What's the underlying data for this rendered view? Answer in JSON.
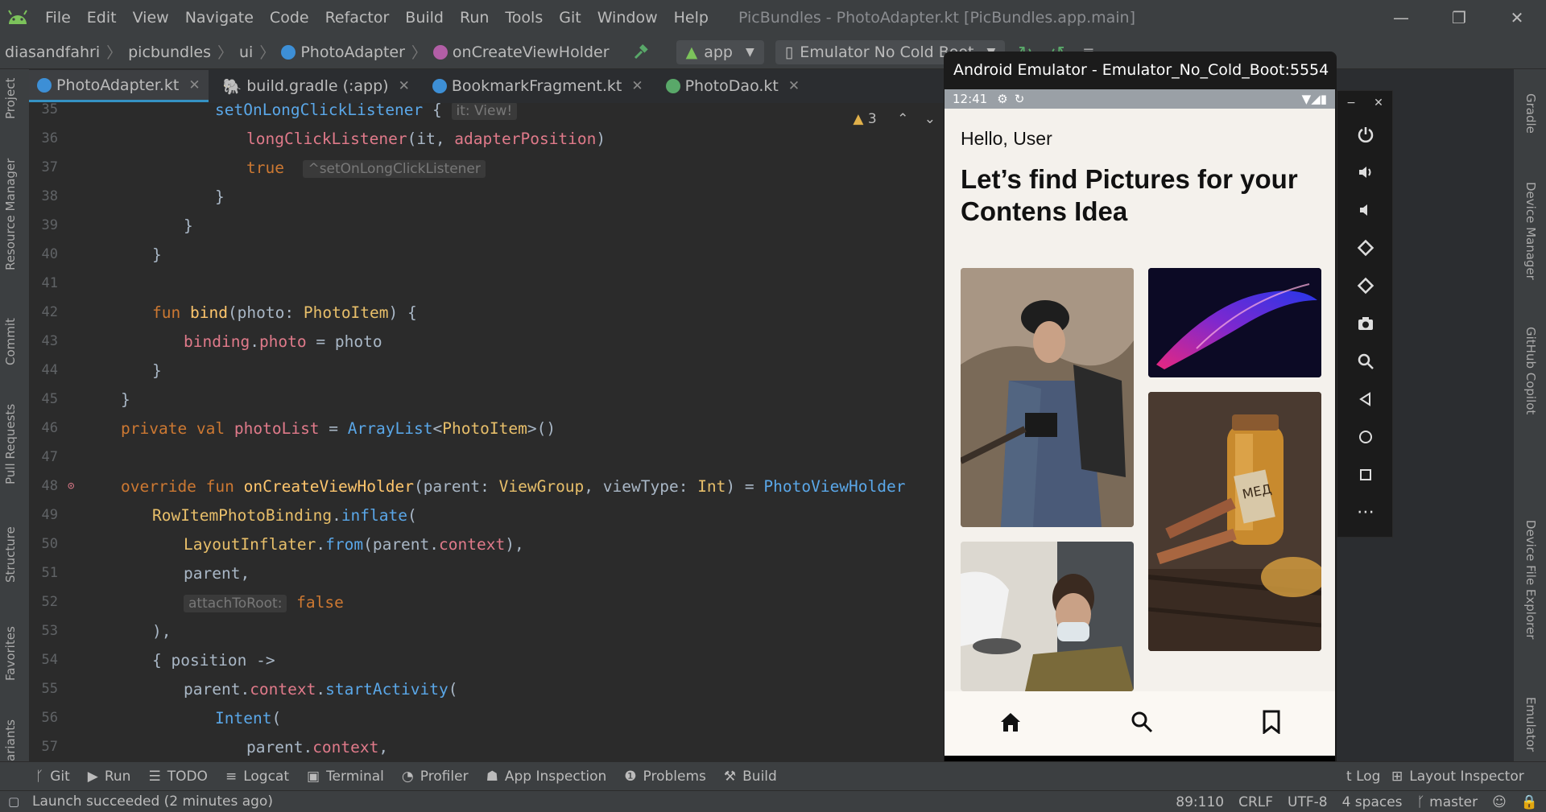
{
  "window": {
    "title": "PicBundles - PhotoAdapter.kt [PicBundles.app.main]",
    "menu": [
      "File",
      "Edit",
      "View",
      "Navigate",
      "Code",
      "Refactor",
      "Build",
      "Run",
      "Tools",
      "Git",
      "Window",
      "Help"
    ],
    "controls": {
      "minimize": "—",
      "restore": "❐",
      "close": "✕"
    }
  },
  "breadcrumb": [
    "diasandfahri",
    "picbundles",
    "ui",
    "PhotoAdapter",
    "onCreateViewHolder"
  ],
  "toolbar": {
    "run_config": "app",
    "device": "Emulator No Cold Boot"
  },
  "tabs": [
    {
      "label": "PhotoAdapter.kt",
      "active": true
    },
    {
      "label": "build.gradle (:app)",
      "active": false
    },
    {
      "label": "BookmarkFragment.kt",
      "active": false
    },
    {
      "label": "PhotoDao.kt",
      "active": false
    }
  ],
  "left_tools": [
    "Project",
    "Resource Manager",
    "Commit",
    "Pull Requests",
    "Structure",
    "Favorites",
    "ariants"
  ],
  "right_tools": [
    "Gradle",
    "Device Manager",
    "GitHub Copilot",
    "Device File Explorer",
    "Emulator"
  ],
  "editor": {
    "warnings": "3",
    "lines": [
      {
        "n": "35",
        "text": "                setOnLongClickListener {",
        "hint": "it: View!"
      },
      {
        "n": "36",
        "text": "                    longClickListener(it, adapterPosition)"
      },
      {
        "n": "37",
        "text": "                    true",
        "hint": "^setOnLongClickListener"
      },
      {
        "n": "38",
        "text": "                }"
      },
      {
        "n": "39",
        "text": "            }"
      },
      {
        "n": "40",
        "text": "        }"
      },
      {
        "n": "41",
        "text": ""
      },
      {
        "n": "42",
        "text": "        fun bind(photo: PhotoItem) {"
      },
      {
        "n": "43",
        "text": "            binding.photo = photo"
      },
      {
        "n": "44",
        "text": "        }"
      },
      {
        "n": "45",
        "text": "    }"
      },
      {
        "n": "46",
        "text": "    private val photoList = ArrayList<PhotoItem>()"
      },
      {
        "n": "47",
        "text": ""
      },
      {
        "n": "48",
        "text": "    override fun onCreateViewHolder(parent: ViewGroup, viewType: Int) = PhotoViewHolder"
      },
      {
        "n": "49",
        "text": "        RowItemPhotoBinding.inflate("
      },
      {
        "n": "50",
        "text": "            LayoutInflater.from(parent.context),"
      },
      {
        "n": "51",
        "text": "            parent,"
      },
      {
        "n": "52",
        "text": "            attachToRoot: false",
        "hint": "attachToRoot:"
      },
      {
        "n": "53",
        "text": "        ),"
      },
      {
        "n": "54",
        "text": "        { position ->"
      },
      {
        "n": "55",
        "text": "            parent.context.startActivity("
      },
      {
        "n": "56",
        "text": "                Intent("
      },
      {
        "n": "57",
        "text": "                    parent.context,"
      }
    ]
  },
  "emulator": {
    "title": "Android Emulator - Emulator_No_Cold_Boot:5554",
    "time": "12:41",
    "greeting": "Hello, User",
    "headline": "Let’s find Pictures for your Contens Idea",
    "honey_label": "МЕД"
  },
  "bottom_tools": [
    "Git",
    "Run",
    "TODO",
    "Logcat",
    "Terminal",
    "Profiler",
    "App Inspection",
    "Problems",
    "Build",
    "t Log",
    "Layout Inspector"
  ],
  "status": {
    "message": "Launch succeeded (2 minutes ago)",
    "position": "89:110",
    "line_sep": "CRLF",
    "encoding": "UTF-8",
    "indent": "4 spaces",
    "branch": "master"
  }
}
